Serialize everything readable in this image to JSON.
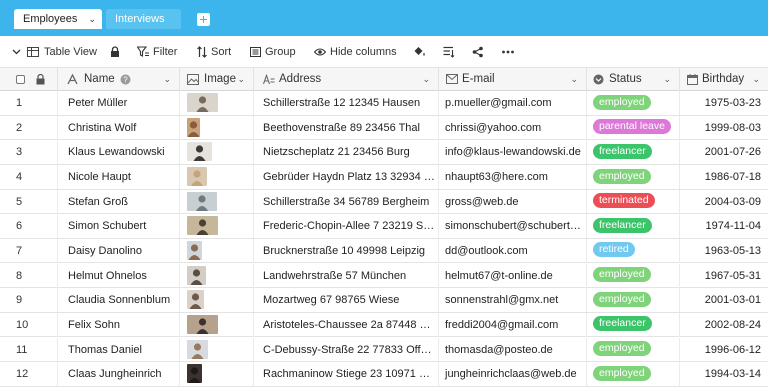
{
  "tabs": {
    "active_label": "Employees",
    "inactive_label": "Interviews"
  },
  "toolbar": {
    "view_label": "Table View",
    "filter_label": "Filter",
    "sort_label": "Sort",
    "group_label": "Group",
    "hide_columns_label": "Hide columns"
  },
  "columns": {
    "name": "Name",
    "image": "Image",
    "address": "Address",
    "email": "E-mail",
    "status": "Status",
    "birthday": "Birthday"
  },
  "status_colors": {
    "employed": "#7fd37a",
    "parental leave": "#dc78d6",
    "freelancer": "#3cc46a",
    "terminated": "#ea4f56",
    "retired": "#72c9ef"
  },
  "rows": [
    {
      "num": "1",
      "name": "Peter Müller",
      "image": "portrait-photo",
      "address": "Schillerstraße 12 12345 Hausen",
      "email": "p.mueller@gmail.com",
      "status": "employed",
      "birthday": "1975-03-23"
    },
    {
      "num": "2",
      "name": "Christina Wolf",
      "image": "portrait-photo",
      "address": "Beethovenstraße 89 23456 Thal",
      "email": "chrissi@yahoo.com",
      "status": "parental leave",
      "birthday": "1999-08-03"
    },
    {
      "num": "3",
      "name": "Klaus Lewandowski",
      "image": "portrait-photo",
      "address": "Nietzscheplatz 21 23456 Burg",
      "email": "info@klaus-lewandowski.de",
      "status": "freelancer",
      "birthday": "2001-07-26"
    },
    {
      "num": "4",
      "name": "Nicole Haupt",
      "image": "portrait-photo",
      "address": "Gebrüder Haydn Platz 13 32934 …",
      "email": "nhaupt63@here.com",
      "status": "employed",
      "birthday": "1986-07-18"
    },
    {
      "num": "5",
      "name": "Stefan Groß",
      "image": "portrait-photo",
      "address": "Schillerstraße 34 56789 Bergheim",
      "email": "gross@web.de",
      "status": "terminated",
      "birthday": "2004-03-09"
    },
    {
      "num": "6",
      "name": "Simon Schubert",
      "image": "portrait-photo",
      "address": "Frederic-Chopin-Allee 7 23219 S…",
      "email": "simonschubert@schubert…",
      "status": "freelancer",
      "birthday": "1974-11-04"
    },
    {
      "num": "7",
      "name": "Daisy Danolino",
      "image": "portrait-photo",
      "address": "Brucknerstraße 10 49998 Leipzig",
      "email": "dd@outlook.com",
      "status": "retired",
      "birthday": "1963-05-13"
    },
    {
      "num": "8",
      "name": "Helmut Ohnelos",
      "image": "portrait-photo",
      "address": "Landwehrstraße 57 München",
      "email": "helmut67@t-online.de",
      "status": "employed",
      "birthday": "1967-05-31"
    },
    {
      "num": "9",
      "name": "Claudia Sonnenblum",
      "image": "portrait-photo",
      "address": "Mozartweg 67 98765 Wiese",
      "email": "sonnenstrahl@gmx.net",
      "status": "employed",
      "birthday": "2001-03-01"
    },
    {
      "num": "10",
      "name": "Felix Sohn",
      "image": "portrait-photo",
      "address": "Aristoteles-Chaussee 2a 87448 …",
      "email": "freddi2004@gmail.com",
      "status": "freelancer",
      "birthday": "2002-08-24"
    },
    {
      "num": "11",
      "name": "Thomas Daniel",
      "image": "portrait-photo",
      "address": "C-Debussy-Straße 22 77833 Off…",
      "email": "thomasda@posteo.de",
      "status": "employed",
      "birthday": "1996-06-12"
    },
    {
      "num": "12",
      "name": "Claas Jungheinrich",
      "image": "portrait-photo",
      "address": "Rachmaninow Stiege 23 10971 …",
      "email": "jungheinrichclaas@web.de",
      "status": "employed",
      "birthday": "1994-03-14"
    }
  ]
}
